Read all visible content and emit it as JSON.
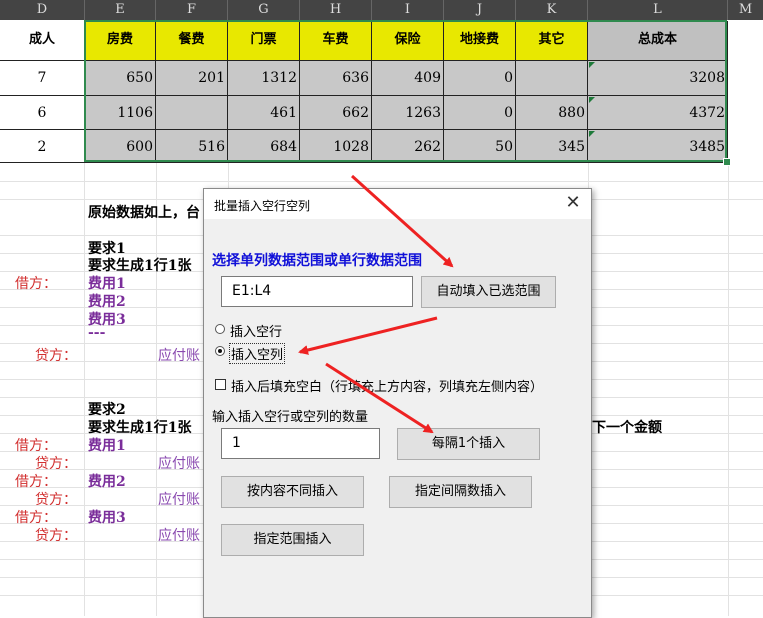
{
  "sheet": {
    "columns": [
      "D",
      "E",
      "F",
      "G",
      "H",
      "I",
      "J",
      "K",
      "L",
      "M"
    ],
    "headers": [
      "成人",
      "房费",
      "餐费",
      "门票",
      "车费",
      "保险",
      "地接费",
      "其它",
      "总成本"
    ],
    "rows": [
      [
        "7",
        "650",
        "201",
        "1312",
        "636",
        "409",
        "0",
        "",
        "3208"
      ],
      [
        "6",
        "1106",
        "",
        "461",
        "662",
        "1263",
        "0",
        "880",
        "4372"
      ],
      [
        "2",
        "600",
        "516",
        "684",
        "1028",
        "262",
        "50",
        "345",
        "3485"
      ]
    ],
    "text": {
      "orig": "原始数据如上，",
      "orig_tail": "台",
      "req1": "要求1",
      "req1_desc": "要求生成1行1张",
      "jie1": "借方：",
      "fee1": "费用1",
      "fee2": "费用2",
      "fee3": "费用3",
      "dots": "---",
      "dai1": "贷方：",
      "pay1": "应付账",
      "req2": "要求2",
      "req2_desc": "要求生成1行1张",
      "req2_tail": "下一个金额",
      "jie2a": "借方：",
      "fee2a": "费用1",
      "dai2a": "贷方：",
      "pay2a": "应付账",
      "jie2b": "借方：",
      "fee2b": "费用2",
      "dai2b": "贷方：",
      "pay2b": "应付账",
      "jie2c": "借方：",
      "fee2c": "费用3",
      "dai2c": "贷方：",
      "pay2c": "应付账"
    }
  },
  "dialog": {
    "title": "批量插入空行空列",
    "range_label": "选择单列数据范围或单行数据范围",
    "range_value": "E1:L4",
    "auto_fill_button": "自动填入已选范围",
    "radio_row": "插入空行",
    "radio_col": "插入空列",
    "selected": "插入空列",
    "fill_blank_label": "插入后填充空白（行填充上方内容，列填充左侧内容）",
    "count_label": "输入插入空行或空列的数量",
    "count_value": "1",
    "every_button": "每隔1个插入",
    "by_content_button": "按内容不同插入",
    "by_interval_button": "指定间隔数插入",
    "by_range_button": "指定范围插入"
  },
  "colors": {
    "header_yellow": "#e8e800",
    "cell_gray": "#c8c8c8",
    "arrow_red": "#ee2222",
    "label_blue": "#1010d8"
  }
}
